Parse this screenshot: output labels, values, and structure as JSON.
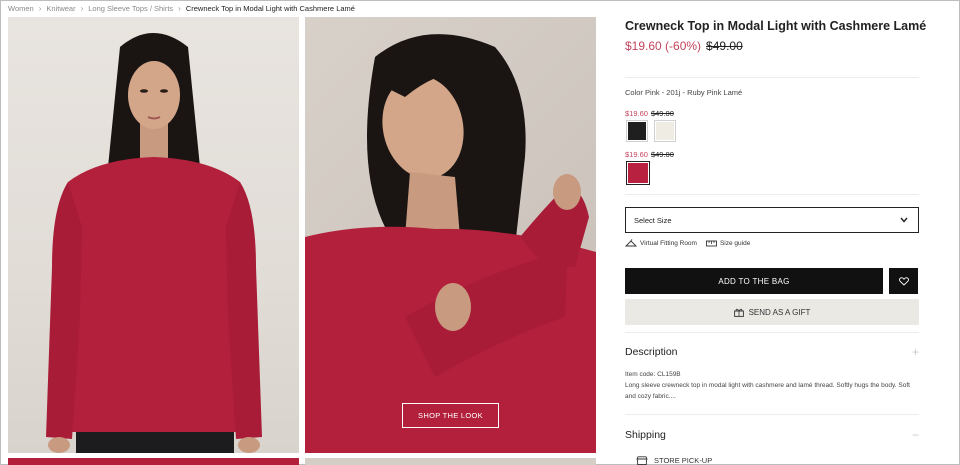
{
  "breadcrumb": {
    "items": [
      "Women",
      "Knitwear",
      "Long Sleeve Tops / Shirts"
    ],
    "current": "Crewneck Top in Modal Light with Cashmere Lamé"
  },
  "gallery": {
    "shop_look_label": "SHOP THE LOOK"
  },
  "product": {
    "title": "Crewneck Top in Modal Light with Cashmere Lamé",
    "price_sale": "$19.60 (-60%)",
    "price_original": "$49.00",
    "color_label": "Color",
    "color_value": "Pink - 201j - Ruby Pink Lamé",
    "swatch_groups": [
      {
        "price_sale": "$19.60",
        "price_original": "$49.00",
        "swatches": [
          {
            "color": "#1f1f1f"
          },
          {
            "color": "#efece4"
          }
        ]
      },
      {
        "price_sale": "$19.60",
        "price_original": "$49.00",
        "swatches": [
          {
            "color": "#b8213f"
          }
        ]
      }
    ]
  },
  "size": {
    "placeholder": "Select Size"
  },
  "links": {
    "fitting_room": "Virtual Fitting Room",
    "size_guide": "Size guide"
  },
  "actions": {
    "add_to_bag": "ADD TO THE BAG",
    "send_gift": "SEND AS A GIFT"
  },
  "description": {
    "heading": "Description",
    "toggle": "+",
    "item_code": "Item code: CL159B",
    "text": "Long sleeve crewneck top in modal light with cashmere and lamé thread. Softly hugs the body. Soft and cozy fabric...."
  },
  "shipping": {
    "heading": "Shipping",
    "toggle": "−",
    "store_pickup": "STORE PICK-UP"
  },
  "colors": {
    "sale": "#c4455d",
    "primary_button": "#111111",
    "gift_button": "#ebe9e4",
    "garment": "#b3203c"
  }
}
